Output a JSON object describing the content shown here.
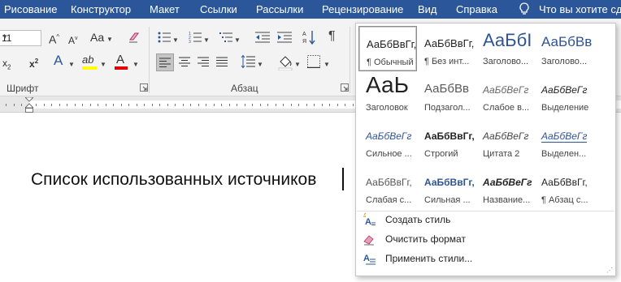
{
  "menu": {
    "tabs": [
      "Рисование",
      "Конструктор",
      "Макет",
      "Ссылки",
      "Рассылки",
      "Рецензирование",
      "Вид",
      "Справка"
    ],
    "tell_me": "Что вы хотите сдел"
  },
  "ribbon": {
    "font_size": "11",
    "font_group_label": "Шрифт",
    "paragraph_group_label": "Абзац",
    "case_button": "Aa",
    "para_mark": "¶"
  },
  "document": {
    "text": "Список использованных источников"
  },
  "gallery": {
    "styles": [
      {
        "preview": "АаБбВвГг,",
        "name": "¶ Обычный"
      },
      {
        "preview": "АаБбВвГг,",
        "name": "¶ Без инт..."
      },
      {
        "preview": "АаБбI",
        "name": "Заголово..."
      },
      {
        "preview": "АаБбВв",
        "name": "Заголово..."
      },
      {
        "preview": "АаЬ",
        "name": "Заголовок"
      },
      {
        "preview": "АаБбВв",
        "name": "Подзагол..."
      },
      {
        "preview": "АаБбВеГг",
        "name": "Слабое в..."
      },
      {
        "preview": "АаБбВеГг",
        "name": "Выделение"
      },
      {
        "preview": "АаБбВеГг",
        "name": "Сильное ..."
      },
      {
        "preview": "АаБбВвГг,",
        "name": "Строгий"
      },
      {
        "preview": "АаБбВеГг",
        "name": "Цитата 2"
      },
      {
        "preview": "АаБбВеГг",
        "name": "Выделен..."
      },
      {
        "preview": "АаБбВвГг,",
        "name": "Слабая с..."
      },
      {
        "preview": "АаБбВвГг,",
        "name": "Сильная ..."
      },
      {
        "preview": "АаБбВеГг",
        "name": "Название..."
      },
      {
        "preview": "АаБбВвГг,",
        "name": "¶ Абзац с..."
      }
    ],
    "actions": {
      "create": "Создать стиль",
      "clear": "Очистить формат",
      "apply": "Применить стили..."
    }
  },
  "colors": {
    "menu_bg": "#2b579a",
    "heading_blue": "#2f5496",
    "highlight": "#ffff00",
    "font_color": "#e00000"
  }
}
